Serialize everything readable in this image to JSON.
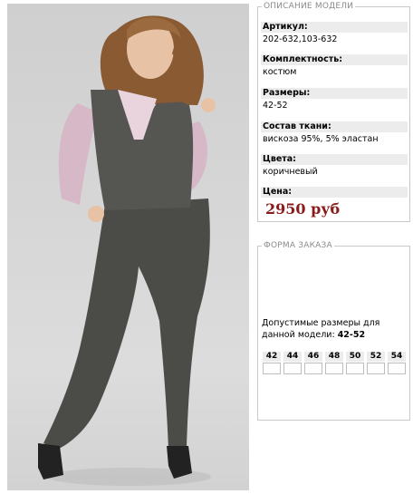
{
  "product": {
    "photo_alt": ""
  },
  "description": {
    "legend": "ОПИСАНИЕ МОДЕЛИ",
    "article_label": "Артикул:",
    "article_value": "202-632,103-632",
    "set_label": "Комплектность:",
    "set_value": "костюм",
    "sizes_label": "Размеры:",
    "sizes_value": "42-52",
    "fabric_label": "Состав ткани:",
    "fabric_value": "вискоза 95%, 5% эластан",
    "colors_label": "Цвета:",
    "colors_value": "коричневый",
    "price_label": "Цена:",
    "price_value": "2950 руб"
  },
  "order": {
    "legend": "ФОРМА ЗАКАЗА",
    "note_text": "Допустимые размеры для данной модели: ",
    "note_sizes": "42-52",
    "sizes": [
      "42",
      "44",
      "46",
      "48",
      "50",
      "52",
      "54"
    ]
  },
  "colors": {
    "price": "#8b1a1a",
    "label_bg": "#ececec",
    "border": "#c8c8c8",
    "legend_text": "#8a8a8a"
  }
}
